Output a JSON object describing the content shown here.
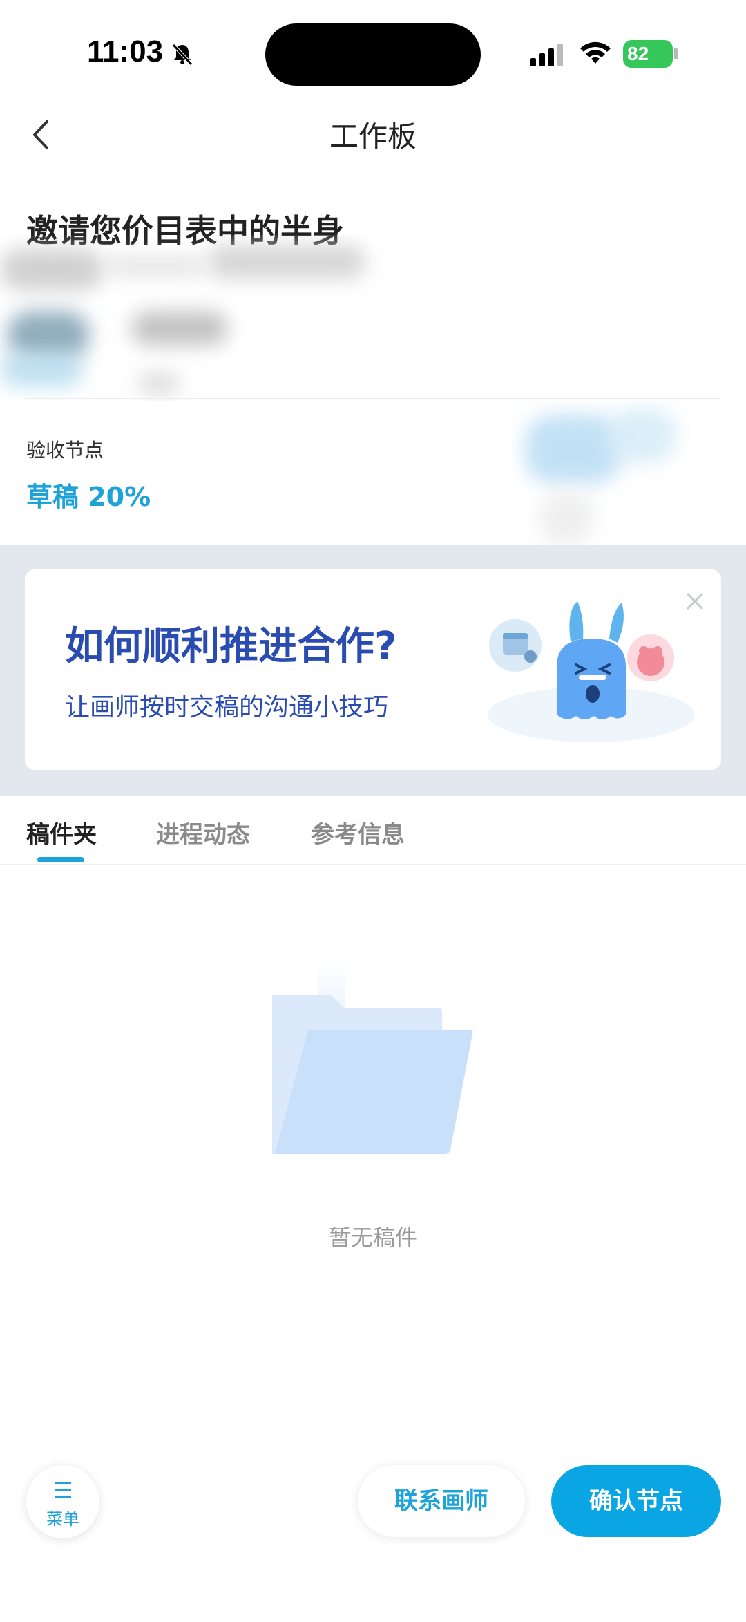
{
  "status_bar": {
    "time": "11:03",
    "battery": "82"
  },
  "nav": {
    "title": "工作板"
  },
  "project": {
    "title": "邀请您价目表中的半身"
  },
  "acceptance": {
    "label": "验收节点",
    "value": "草稿 20%"
  },
  "banner": {
    "title": "如何顺利推进合作?",
    "subtitle": "让画师按时交稿的沟通小技巧"
  },
  "tabs": [
    {
      "label": "稿件夹",
      "active": true
    },
    {
      "label": "进程动态",
      "active": false
    },
    {
      "label": "参考信息",
      "active": false
    }
  ],
  "empty_state": {
    "text": "暂无稿件"
  },
  "bottom_bar": {
    "menu_label": "菜单",
    "contact_label": "联系画师",
    "confirm_label": "确认节点"
  },
  "colors": {
    "accent": "#1ea3d9",
    "confirm_bg": "#0aa6e4",
    "banner_text": "#2a4bb0",
    "banner_bg": "#e3e8ee"
  },
  "icons": [
    "bell-muted-icon",
    "signal-icon",
    "wifi-icon",
    "battery-icon",
    "back-arrow-icon",
    "close-icon",
    "mascot-illustration",
    "empty-folder-icon",
    "menu-icon"
  ]
}
